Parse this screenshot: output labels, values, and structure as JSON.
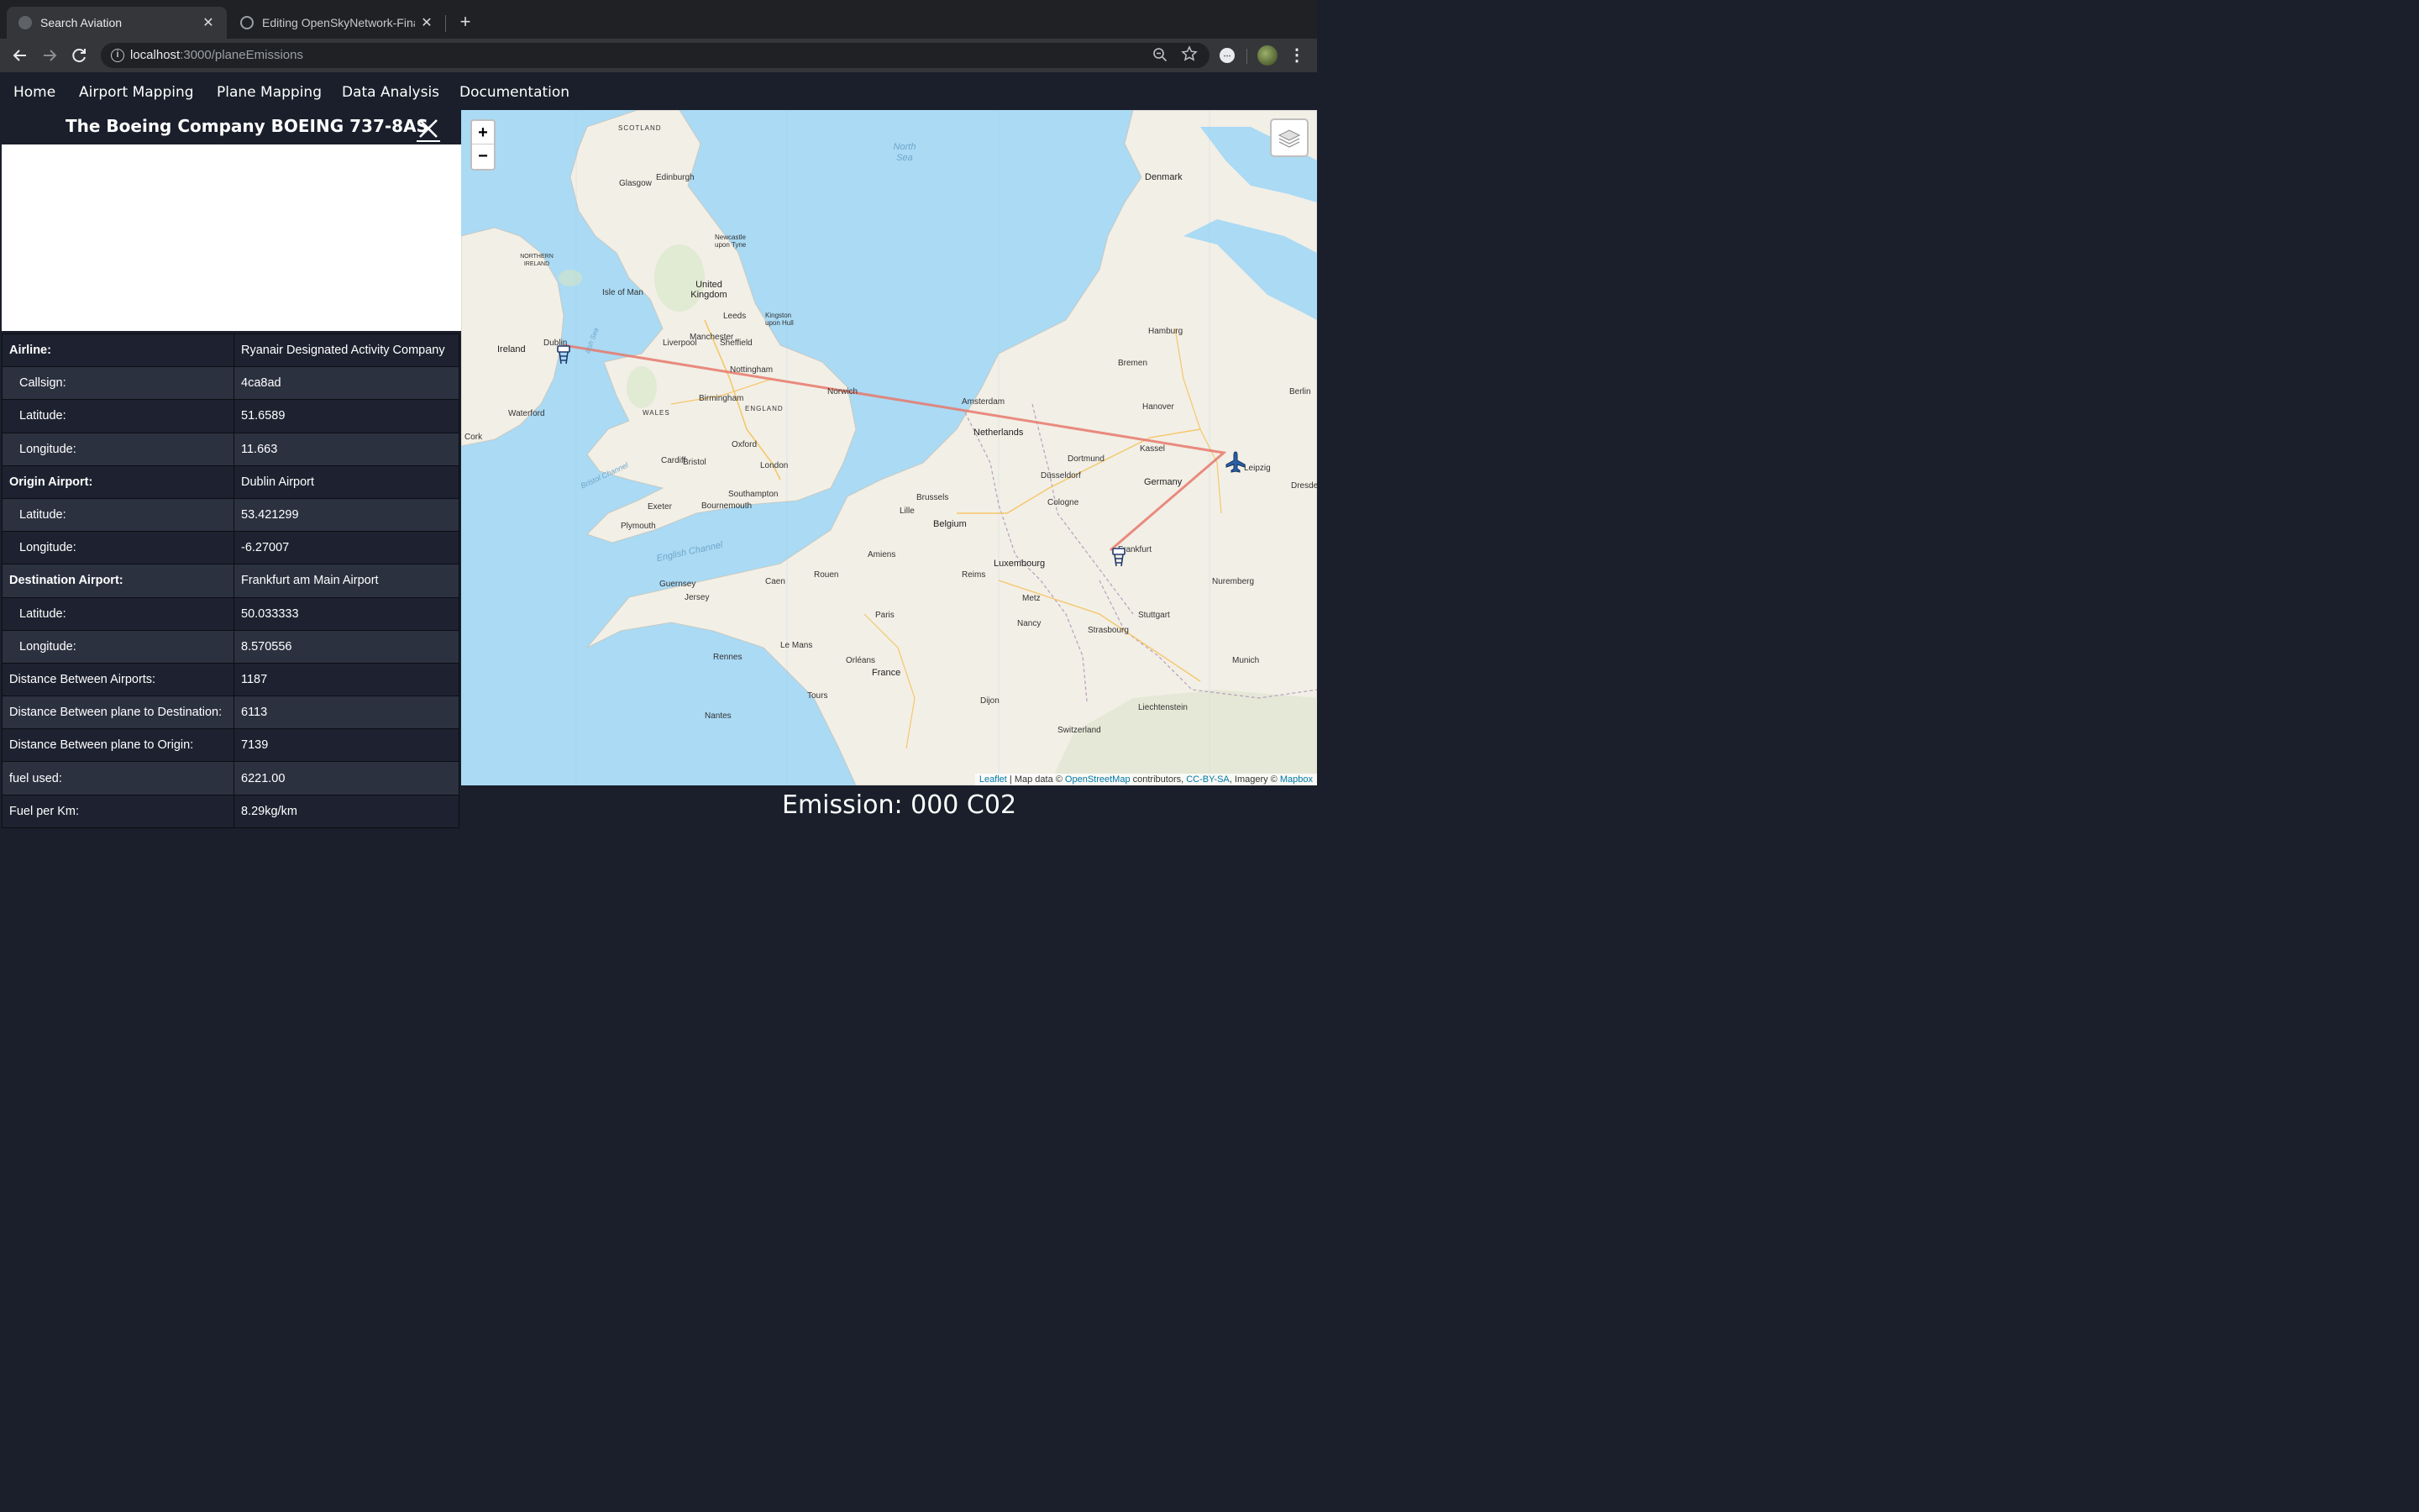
{
  "browser": {
    "tabs": [
      {
        "label": "Search Aviation",
        "close": "✕"
      },
      {
        "label": "Editing OpenSkyNetwork-Final",
        "close": "✕"
      }
    ],
    "new_tab": "+",
    "url_host": "localhost",
    "url_rest": ":3000/planeEmissions",
    "icons": {
      "back": "back-arrow-icon",
      "forward": "forward-arrow-icon",
      "reload": "reload-icon"
    }
  },
  "nav": {
    "links": [
      "Home",
      "Airport Mapping",
      "Plane Mapping",
      "Data Analysis",
      "Documentation"
    ]
  },
  "panel": {
    "title": "The Boeing Company BOEING 737-8AS",
    "rows": [
      {
        "key": "Airline:",
        "value": "Ryanair Designated Activity Company"
      },
      {
        "key": "Callsign:",
        "value": "4ca8ad"
      },
      {
        "key": "Latitude:",
        "value": "51.6589"
      },
      {
        "key": "Longitude:",
        "value": "11.663"
      },
      {
        "key": "Origin Airport:",
        "value": "Dublin Airport"
      },
      {
        "key": "Latitude:",
        "value": "53.421299"
      },
      {
        "key": "Longitude:",
        "value": "-6.27007"
      },
      {
        "key": "Destination Airport:",
        "value": "Frankfurt am Main Airport"
      },
      {
        "key": "Latitude:",
        "value": "50.033333"
      },
      {
        "key": "Longitude:",
        "value": "8.570556"
      },
      {
        "key": "Distance Between Airports:",
        "value": "1187"
      },
      {
        "key": "Distance Between plane to Destination:",
        "value": "6113"
      },
      {
        "key": "Distance Between plane to Origin:",
        "value": "7139"
      },
      {
        "key": "fuel used:",
        "value": "6221.00"
      },
      {
        "key": "Fuel per Km:",
        "value": "8.29kg/km"
      }
    ]
  },
  "map": {
    "zoom_in": "+",
    "zoom_out": "−",
    "countries": [
      "Ireland",
      "United Kingdom",
      "ENGLAND",
      "WALES",
      "SCOTLAND",
      "NORTHERN IRELAND",
      "Netherlands",
      "Belgium",
      "Luxembourg",
      "Germany",
      "France",
      "Denmark",
      "Switzerland",
      "Liechtenstein"
    ],
    "seas": [
      "North Sea",
      "English Channel",
      "Bristol Channel",
      "Irish Sea"
    ],
    "cities": [
      "Dublin",
      "London",
      "Birmingham",
      "Manchester",
      "Liverpool",
      "Leeds",
      "Sheffield",
      "Nottingham",
      "Norwich",
      "Cardiff",
      "Bristol",
      "Brussels",
      "Paris",
      "Frankfurt",
      "Hamburg",
      "Hanover",
      "Cologne",
      "Leipzig",
      "Dresden",
      "Amsterdam",
      "Edinburgh",
      "Glasgow",
      "Newcastle upon Tyne",
      "Cork",
      "Waterford",
      "Isle of Man",
      "Guernsey",
      "Jersey",
      "Kingston upon Hull",
      "Oxford",
      "Exeter",
      "Plymouth",
      "Bournemouth",
      "Southampton",
      "Lille",
      "Strasbourg",
      "Stuttgart",
      "Nuremberg",
      "Munich",
      "Kassel",
      "Dortmund",
      "Düsseldorf",
      "Reims",
      "Rennes",
      "Le Mans",
      "Tours",
      "Orléans",
      "Dijon",
      "Nantes",
      "Caen",
      "Rouen",
      "Amiens",
      "Metz",
      "Nancy",
      "Bremen",
      "Berlin"
    ],
    "attribution": {
      "leaflet": "Leaflet",
      "text1": " | Map data © ",
      "osm": "OpenStreetMap",
      "text2": " contributors, ",
      "license": "CC-BY-SA",
      "text3": ", Imagery © ",
      "mapbox": "Mapbox"
    },
    "route_color": "#e8786b",
    "water_color": "#aadaf4",
    "land_color": "#f2efe6"
  },
  "emission": {
    "text": "Emission: 000 C02"
  }
}
